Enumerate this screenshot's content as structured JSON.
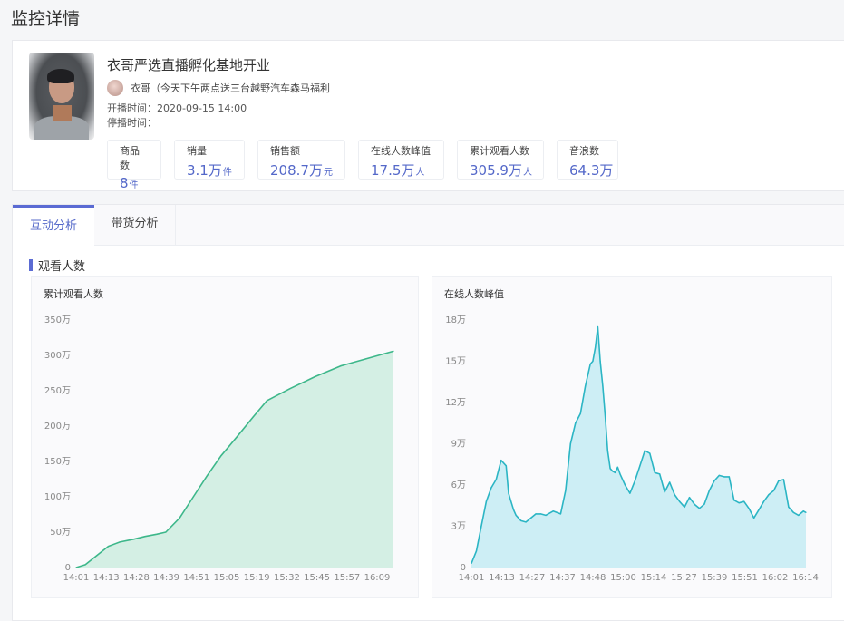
{
  "page": {
    "title": "监控详情"
  },
  "live": {
    "title": "衣哥严选直播孵化基地开业",
    "anchor": "衣哥（今天下午两点送三台越野汽车森马福利",
    "start_label": "开播时间：",
    "start_time": "2020-09-15 14:00",
    "end_label": "停播时间：",
    "end_time": ""
  },
  "stats": [
    {
      "label": "商品数",
      "value": "8",
      "unit": "件"
    },
    {
      "label": "销量",
      "value": "3.1万",
      "unit": "件"
    },
    {
      "label": "销售额",
      "value": "208.7万",
      "unit": "元"
    },
    {
      "label": "在线人数峰值",
      "value": "17.5万",
      "unit": "人"
    },
    {
      "label": "累计观看人数",
      "value": "305.9万",
      "unit": "人"
    },
    {
      "label": "音浪数",
      "value": "64.3万",
      "unit": ""
    }
  ],
  "tabs": [
    {
      "label": "互动分析",
      "active": true
    },
    {
      "label": "带货分析",
      "active": false
    }
  ],
  "section": {
    "title": "观看人数"
  },
  "colors": {
    "accent": "#5b6bd3",
    "cumulative_line": "#3db78a",
    "cumulative_fill": "#d4efe4",
    "peak_line": "#2bb5c4",
    "peak_fill": "#cdeef5"
  },
  "chart_data": [
    {
      "type": "area",
      "title": "累计观看人数",
      "xlabel": "",
      "ylabel": "",
      "ylim": [
        0,
        350
      ],
      "yticks": [
        0,
        50,
        100,
        150,
        200,
        250,
        300,
        350
      ],
      "ytick_labels": [
        "0",
        "50万",
        "100万",
        "150万",
        "200万",
        "250万",
        "300万",
        "350万"
      ],
      "xtick_labels": [
        "14:01",
        "14:13",
        "14:28",
        "14:39",
        "14:51",
        "15:05",
        "15:19",
        "15:32",
        "15:45",
        "15:57",
        "16:09"
      ],
      "x_range_minutes": [
        0,
        138
      ],
      "series": [
        {
          "name": "累计观看人数",
          "unit": "万",
          "x_minutes": [
            0,
            4,
            9,
            14,
            19,
            25,
            30,
            35,
            39,
            45,
            51,
            57,
            63,
            70,
            77,
            83,
            93,
            104,
            115,
            126,
            138
          ],
          "values": [
            0,
            4,
            17,
            30,
            36,
            40,
            44,
            47,
            50,
            70,
            100,
            130,
            158,
            185,
            213,
            236,
            253,
            270,
            285,
            295,
            305.9
          ]
        }
      ]
    },
    {
      "type": "area",
      "title": "在线人数峰值",
      "xlabel": "",
      "ylabel": "",
      "ylim": [
        0,
        18
      ],
      "yticks": [
        0,
        3,
        6,
        9,
        12,
        15,
        18
      ],
      "ytick_labels": [
        "0",
        "3万",
        "6万",
        "9万",
        "12万",
        "15万",
        "18万"
      ],
      "xtick_labels": [
        "14:01",
        "14:13",
        "14:27",
        "14:37",
        "14:48",
        "15:00",
        "15:14",
        "15:27",
        "15:39",
        "15:51",
        "16:02",
        "16:14"
      ],
      "x_range_minutes": [
        0,
        135
      ],
      "series": [
        {
          "name": "在线人数峰值",
          "unit": "万",
          "x_minutes": [
            0,
            2,
            4,
            6,
            8,
            10,
            12,
            14,
            15,
            16,
            17,
            18,
            20,
            22,
            24,
            26,
            28,
            30,
            33,
            36,
            38,
            40,
            42,
            44,
            46,
            48,
            49,
            50,
            51,
            52,
            53,
            54,
            55,
            56,
            57,
            58,
            59,
            60,
            62,
            64,
            66,
            68,
            70,
            72,
            74,
            76,
            78,
            80,
            82,
            84,
            86,
            88,
            90,
            92,
            94,
            96,
            98,
            100,
            102,
            104,
            106,
            108,
            110,
            112,
            114,
            116,
            118,
            120,
            122,
            124,
            126,
            128,
            130,
            132,
            134,
            135
          ],
          "values": [
            0.3,
            1.2,
            3.0,
            4.8,
            5.8,
            6.4,
            7.8,
            7.4,
            5.4,
            4.8,
            4.2,
            3.8,
            3.4,
            3.3,
            3.6,
            3.9,
            3.9,
            3.8,
            4.1,
            3.9,
            5.6,
            9.0,
            10.5,
            11.2,
            13.2,
            14.8,
            15.0,
            16.0,
            17.5,
            15.0,
            13.2,
            11.0,
            8.5,
            7.2,
            7.0,
            6.9,
            7.3,
            6.8,
            6.0,
            5.4,
            6.3,
            7.4,
            8.5,
            8.3,
            6.9,
            6.8,
            5.5,
            6.2,
            5.3,
            4.8,
            4.4,
            5.1,
            4.6,
            4.3,
            4.6,
            5.6,
            6.3,
            6.7,
            6.6,
            6.6,
            4.9,
            4.7,
            4.8,
            4.3,
            3.6,
            4.2,
            4.8,
            5.3,
            5.6,
            6.3,
            6.4,
            4.4,
            4.0,
            3.8,
            4.1,
            4.0
          ]
        }
      ]
    }
  ]
}
